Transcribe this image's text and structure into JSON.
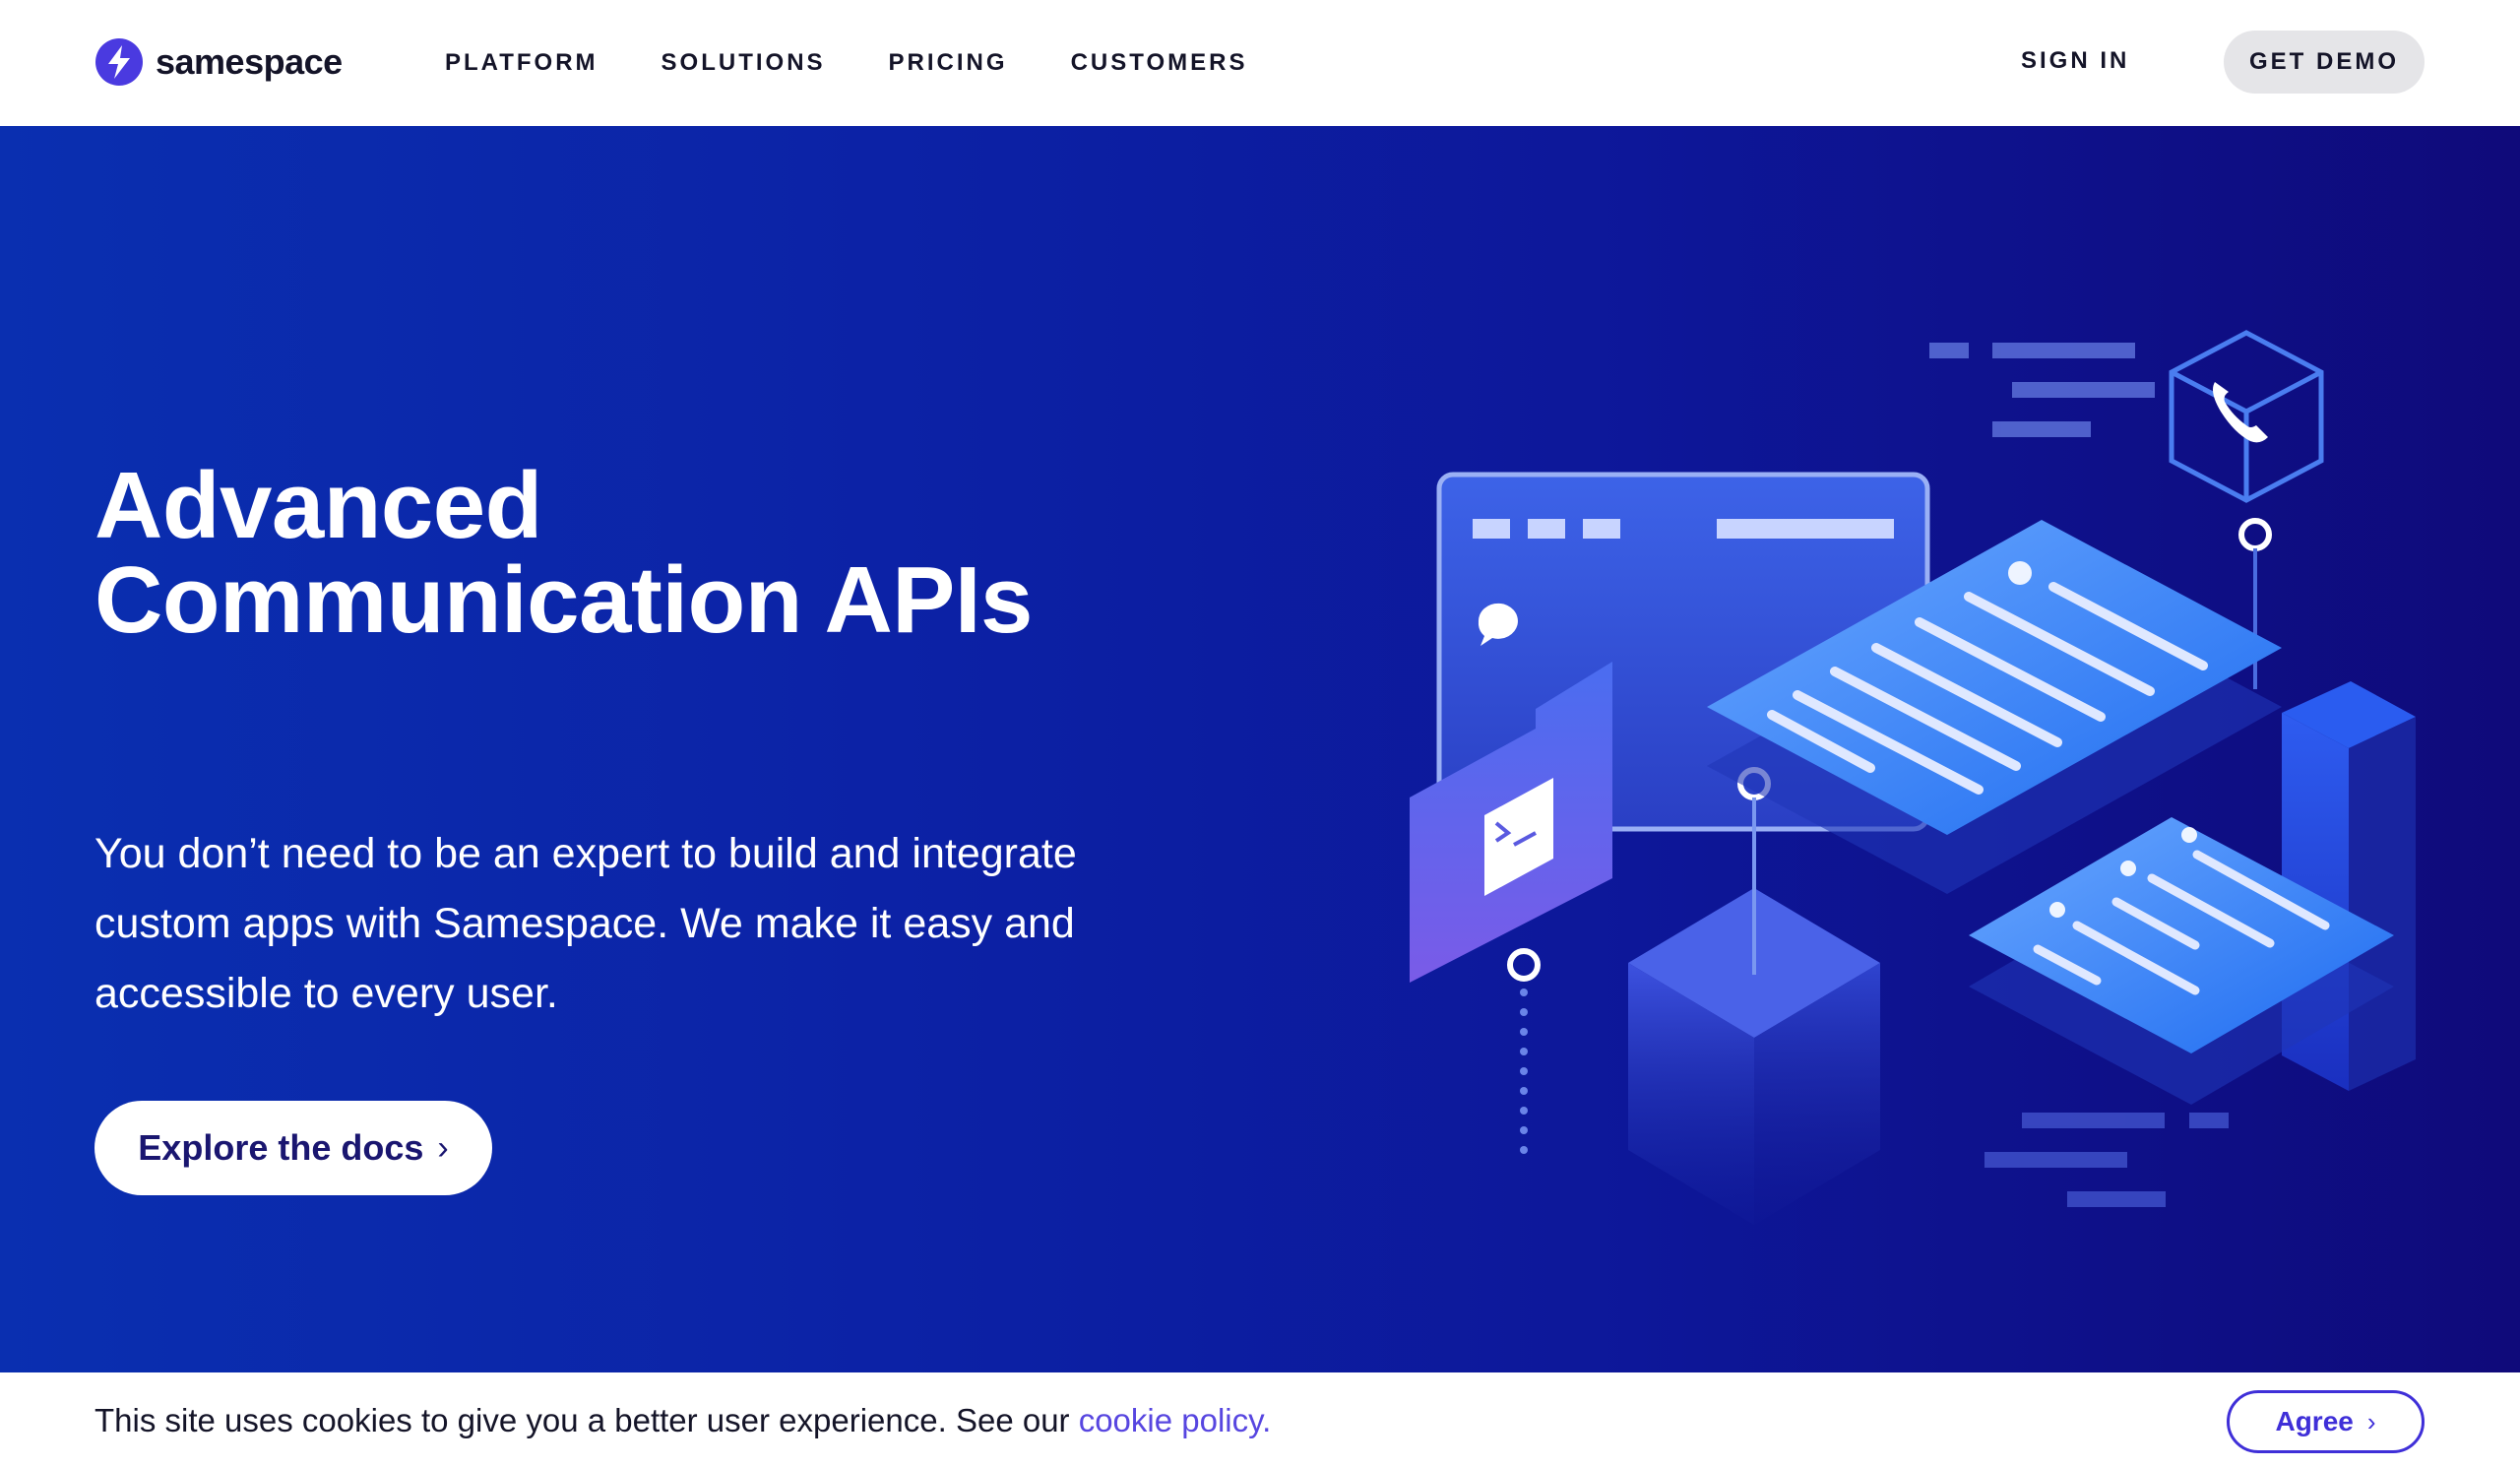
{
  "header": {
    "logo_text": "samespace",
    "nav": [
      "PLATFORM",
      "SOLUTIONS",
      "PRICING",
      "CUSTOMERS"
    ],
    "sign_in": "SIGN IN",
    "get_demo": "GET DEMO"
  },
  "hero": {
    "title_line1": "Advanced",
    "title_line2": "Communication APIs",
    "subtitle": "You don’t need to be an expert to build and integrate custom apps with Samespace. We make it easy and accessible to every user.",
    "cta_label": "Explore the docs",
    "cta_icon": "chevron-right-icon"
  },
  "cookie_bar": {
    "text": "This site uses cookies to give you a better user experience. See our ",
    "link_text": "cookie policy.",
    "agree_label": "Agree",
    "agree_icon": "chevron-right-icon"
  },
  "colors": {
    "hero_start": "#0a2fb0",
    "hero_end": "#0f0a7a",
    "brand": "#3f2fd8",
    "text_dark": "#141428"
  }
}
